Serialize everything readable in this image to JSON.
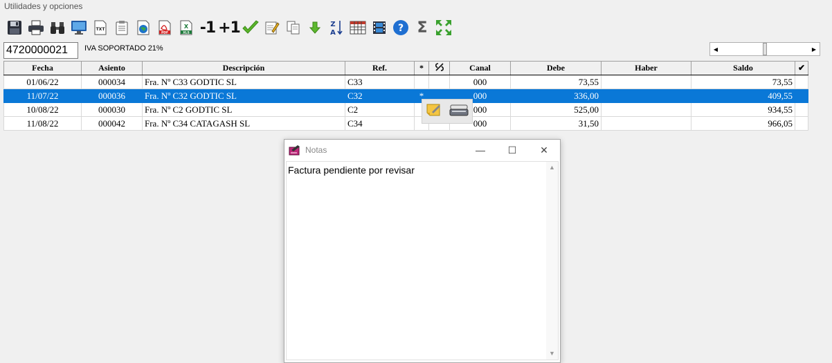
{
  "menubar": {
    "title": "Utilidades y opciones"
  },
  "toolbar": {
    "icons": [
      "save-icon",
      "print-icon",
      "binoculars-icon",
      "monitor-icon",
      "txt-file-icon",
      "clipboard-icon",
      "web-icon",
      "pdf-icon",
      "xls-icon",
      "minus-one-icon",
      "plus-one-icon",
      "checkmark-icon",
      "edit-note-icon",
      "copy-icon",
      "arrow-down-icon",
      "sort-az-icon",
      "table-icon",
      "film-icon",
      "help-icon",
      "sigma-icon",
      "expand-icon"
    ],
    "minus_one": "-1",
    "plus_one": "+1",
    "txt_label": "TXT",
    "pdf_label": "PDF",
    "xls_label": "XLS",
    "sort_a": "A",
    "sort_z": "Z",
    "sigma": "Σ"
  },
  "account": {
    "code": "4720000021",
    "name": "IVA SOPORTADO 21%"
  },
  "grid": {
    "headers": {
      "fecha": "Fecha",
      "asiento": "Asiento",
      "descripcion": "Descripción",
      "ref": "Ref.",
      "star": "*",
      "canal": "Canal",
      "debe": "Debe",
      "haber": "Haber",
      "saldo": "Saldo",
      "check": "✔"
    },
    "rows": [
      {
        "fecha": "01/06/22",
        "asiento": "000034",
        "descripcion": "Fra. Nº C33 GODTIC SL",
        "ref": "C33",
        "star": "",
        "canal": "000",
        "debe": "73,55",
        "haber": "",
        "saldo": "73,55"
      },
      {
        "fecha": "11/07/22",
        "asiento": "000036",
        "descripcion": "Fra. Nº C32 GODTIC SL",
        "ref": "C32",
        "star": "*",
        "canal": "000",
        "debe": "336,00",
        "haber": "",
        "saldo": "409,55"
      },
      {
        "fecha": "10/08/22",
        "asiento": "000030",
        "descripcion": "Fra. Nº C2 GODTIC SL",
        "ref": "C2",
        "star": "",
        "canal": "000",
        "debe": "525,00",
        "haber": "",
        "saldo": "934,55"
      },
      {
        "fecha": "11/08/22",
        "asiento": "000042",
        "descripcion": "Fra. Nº C34 CATAGASH SL",
        "ref": "C34",
        "star": "",
        "canal": "000",
        "debe": "31,50",
        "haber": "",
        "saldo": "966,05"
      }
    ],
    "selected_row": 1
  },
  "notes_window": {
    "title": "Notas",
    "content": "Factura pendiente por revisar",
    "minimize": "—",
    "maximize": "☐",
    "close": "✕"
  },
  "colors": {
    "selection": "#0a78d7",
    "background": "#f0f0f0"
  }
}
